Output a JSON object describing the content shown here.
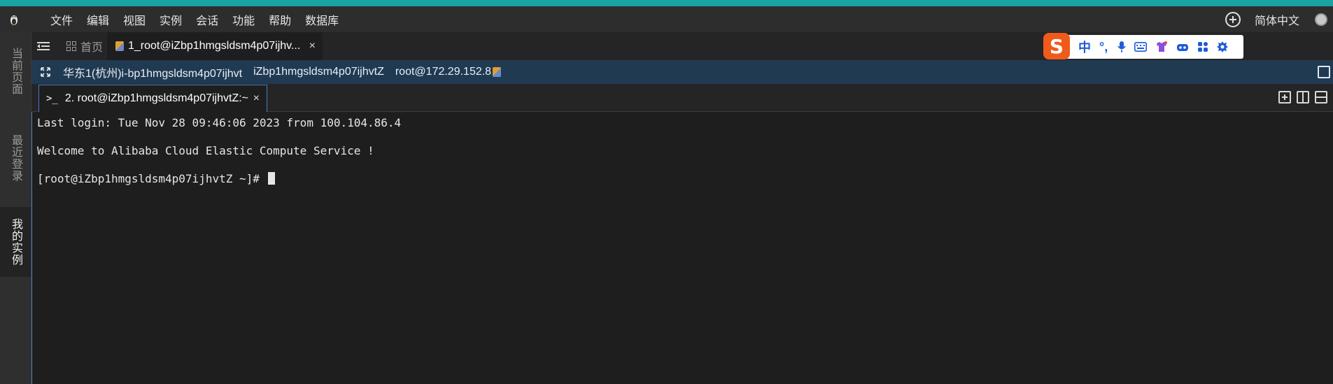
{
  "menubar": {
    "items": [
      "文件",
      "编辑",
      "视图",
      "实例",
      "会话",
      "功能",
      "帮助",
      "数据库"
    ],
    "language": "简体中文"
  },
  "sidebar": {
    "items": [
      {
        "label": "当前页面",
        "icon": "page-icon"
      },
      {
        "label": "最近登录",
        "icon": "clock-icon"
      },
      {
        "label": "我的实例",
        "icon": "list-icon"
      }
    ]
  },
  "tabbar": {
    "home_label": "首页",
    "session_tab_label": "1_root@iZbp1hmgsldsm4p07ijhv...",
    "close_glyph": "×"
  },
  "ime": {
    "logo": "S",
    "mode_label": "中",
    "punct_label": "°,"
  },
  "infobar": {
    "region": "华东1(杭州)i-bp1hmgsldsm4p07ijhvt",
    "hostname": "iZbp1hmgsldsm4p07ijhvtZ",
    "user_ip": "root@172.29.152.8"
  },
  "terminal_tab": {
    "icon_glyph": ">_",
    "label": "2. root@iZbp1hmgsldsm4p07ijhvtZ:~",
    "close_glyph": "×"
  },
  "terminal": {
    "lines": [
      "Last login: Tue Nov 28 09:46:06 2023 from 100.104.86.4",
      "Welcome to Alibaba Cloud Elastic Compute Service !",
      "[root@iZbp1hmgsldsm4p07ijhvtZ ~]# "
    ]
  },
  "colors": {
    "accent_stripe": "#1aa3a3",
    "infobar_bg": "#203a52",
    "terminal_bg": "#1e1e1e",
    "ime_brand": "#f05a1a"
  }
}
